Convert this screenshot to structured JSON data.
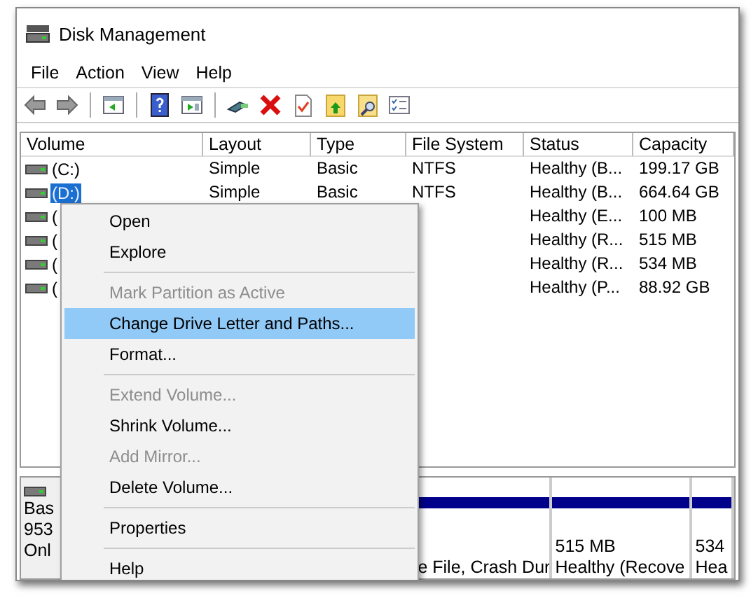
{
  "window": {
    "title": "Disk Management"
  },
  "menu_bar": [
    "File",
    "Action",
    "View",
    "Help"
  ],
  "toolbar": [
    {
      "kind": "back",
      "disabled": false
    },
    {
      "kind": "forward",
      "disabled": false
    },
    {
      "kind": "sep"
    },
    {
      "kind": "console",
      "disabled": false
    },
    {
      "kind": "sep"
    },
    {
      "kind": "help",
      "disabled": false
    },
    {
      "kind": "pane",
      "disabled": false
    },
    {
      "kind": "sep"
    },
    {
      "kind": "connect",
      "disabled": false
    },
    {
      "kind": "delete",
      "disabled": false
    },
    {
      "kind": "check",
      "disabled": false
    },
    {
      "kind": "folder-up",
      "disabled": false
    },
    {
      "kind": "find",
      "disabled": false
    },
    {
      "kind": "list",
      "disabled": false
    }
  ],
  "table": {
    "columns": [
      "Volume",
      "Layout",
      "Type",
      "File System",
      "Status",
      "Capacity"
    ],
    "rows": [
      {
        "volume": "(C:)",
        "layout": "Simple",
        "type": "Basic",
        "file_system": "NTFS",
        "status": "Healthy (B...",
        "capacity": "199.17 GB",
        "selected": false
      },
      {
        "volume": "(D:)",
        "layout": "Simple",
        "type": "Basic",
        "file_system": "NTFS",
        "status": "Healthy (B...",
        "capacity": "664.64 GB",
        "selected": true
      },
      {
        "volume": "(",
        "status": "Healthy (E...",
        "capacity": "100 MB",
        "selected": false
      },
      {
        "volume": "(",
        "status": "Healthy (R...",
        "capacity": "515 MB",
        "selected": false
      },
      {
        "volume": "(",
        "status": "Healthy (R...",
        "capacity": "534 MB",
        "selected": false
      },
      {
        "volume": "(",
        "status": "Healthy (P...",
        "capacity": "88.92 GB",
        "selected": false
      }
    ]
  },
  "disk_pane": {
    "disk_info": [
      "Bas",
      "953",
      "Onl"
    ],
    "partitions": [
      {
        "lines": [
          "e File, Crash Dur"
        ]
      },
      {
        "lines": [
          "515 MB",
          "Healthy (Recove"
        ]
      },
      {
        "lines": [
          "534",
          "Hea"
        ]
      }
    ]
  },
  "context_menu": [
    {
      "kind": "item",
      "label": "Open",
      "disabled": false,
      "selected": false
    },
    {
      "kind": "item",
      "label": "Explore",
      "disabled": false,
      "selected": false
    },
    {
      "kind": "separator"
    },
    {
      "kind": "item",
      "label": "Mark Partition as Active",
      "disabled": true,
      "selected": false
    },
    {
      "kind": "item",
      "label": "Change Drive Letter and Paths...",
      "disabled": false,
      "selected": true
    },
    {
      "kind": "item",
      "label": "Format...",
      "disabled": false,
      "selected": false
    },
    {
      "kind": "separator"
    },
    {
      "kind": "item",
      "label": "Extend Volume...",
      "disabled": true,
      "selected": false
    },
    {
      "kind": "item",
      "label": "Shrink Volume...",
      "disabled": false,
      "selected": false
    },
    {
      "kind": "item",
      "label": "Add Mirror...",
      "disabled": true,
      "selected": false
    },
    {
      "kind": "item",
      "label": "Delete Volume...",
      "disabled": false,
      "selected": false
    },
    {
      "kind": "separator"
    },
    {
      "kind": "item",
      "label": "Properties",
      "disabled": false,
      "selected": false
    },
    {
      "kind": "separator"
    },
    {
      "kind": "item",
      "label": "Help",
      "disabled": false,
      "selected": false
    }
  ]
}
